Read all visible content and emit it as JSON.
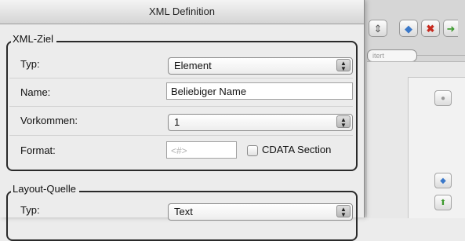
{
  "window": {
    "title": "XML Definition"
  },
  "xml_ziel": {
    "legend": "XML-Ziel",
    "typ": {
      "label": "Typ:",
      "value": "Element"
    },
    "name": {
      "label": "Name:",
      "value": "Beliebiger Name"
    },
    "vorkommen": {
      "label": "Vorkommen:",
      "value": "1"
    },
    "format": {
      "label": "Format:",
      "placeholder": "<#>",
      "cdata_label": "CDATA Section"
    }
  },
  "layout_quelle": {
    "legend": "Layout-Quelle",
    "typ": {
      "label": "Typ:",
      "value": "Text"
    }
  },
  "background": {
    "pill_text": "itert",
    "toolbar_icons": [
      "stepper-icon",
      "diamond-icon",
      "delete-icon",
      "add-arrow-icon"
    ],
    "side_icons": [
      "dot-icon",
      "diamond-icon",
      "up-arrow-icon"
    ]
  },
  "colors": {
    "accent_blue": "#3a78c9",
    "delete_red": "#c72a1f",
    "add_green": "#3d9a2f"
  }
}
